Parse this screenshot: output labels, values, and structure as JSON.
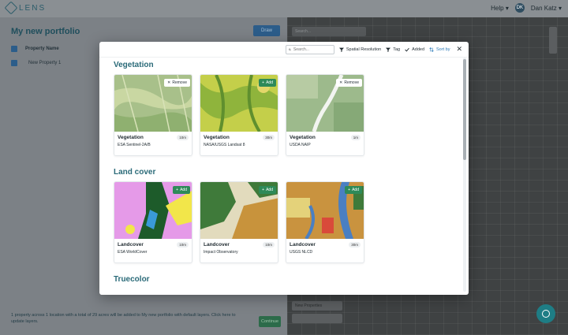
{
  "app": {
    "logo_text": "LENS",
    "help_label": "Help",
    "user_initials": "DK",
    "user_name": "Dan Katz"
  },
  "portfolio": {
    "title": "My new portfolio",
    "draw_label": "Draw",
    "column_header": "Property Name",
    "rows": [
      {
        "name": "New Property 1"
      }
    ],
    "bottom_note": "1 property across 1 location with a total of 29 acres will be added to My new portfolio with default layers. Click here to update layers.",
    "continue_label": "Continue"
  },
  "map": {
    "search_placeholder": "Search...",
    "badge_text": "New Properties"
  },
  "modal": {
    "search_placeholder": "Search...",
    "filters": {
      "spatial_resolution": "Spatial Resolution",
      "tag": "Tag",
      "added": "Added",
      "sort_by": "Sort by"
    },
    "sections": [
      {
        "title": "Vegetation",
        "cards": [
          {
            "type": "Vegetation",
            "source": "ESA Sentinel-2A/B",
            "resolution": "10m",
            "action": "Remove"
          },
          {
            "type": "Vegetation",
            "source": "NASA/USGS Landsat 8",
            "resolution": "30m",
            "action": "Add"
          },
          {
            "type": "Vegetation",
            "source": "USDA NAIP",
            "resolution": "1m",
            "action": "Remove"
          }
        ]
      },
      {
        "title": "Land cover",
        "cards": [
          {
            "type": "Landcover",
            "source": "ESA WorldCover",
            "resolution": "10m",
            "action": "Add"
          },
          {
            "type": "Landcover",
            "source": "Impact Observatory",
            "resolution": "10m",
            "action": "Add"
          },
          {
            "type": "Landcover",
            "source": "USGS NLCD",
            "resolution": "30m",
            "action": "Add"
          }
        ]
      },
      {
        "title": "Truecolor",
        "cards": []
      }
    ]
  },
  "colors": {
    "accent": "#2a6a78",
    "add_button": "#2e8a59",
    "sort_accent": "#2a7ab8"
  }
}
